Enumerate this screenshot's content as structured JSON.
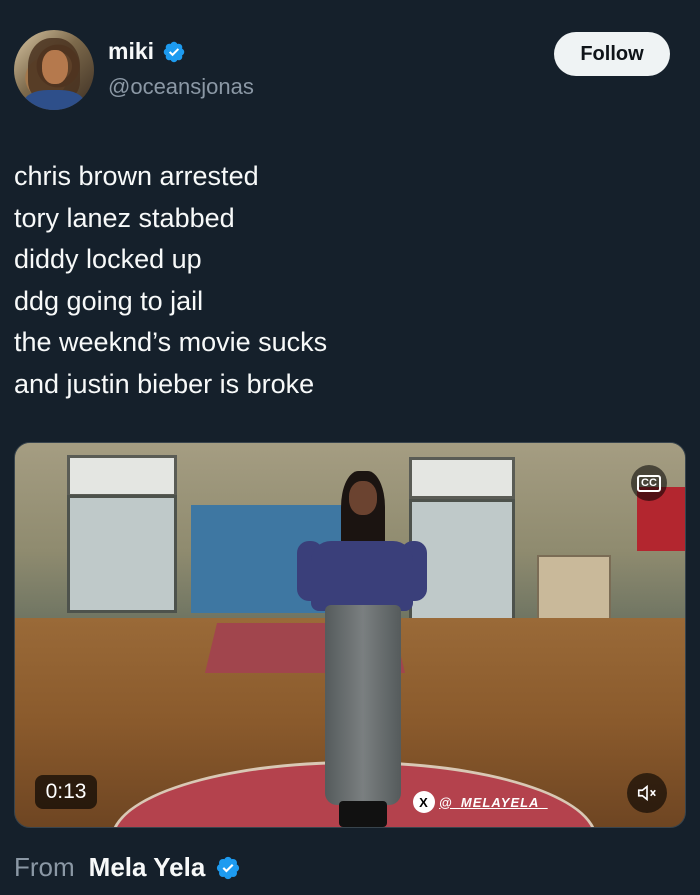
{
  "user": {
    "display_name": "miki",
    "handle": "@oceansjonas",
    "verified_icon": "verified-badge-icon",
    "verified_color": "#1d9bf0"
  },
  "follow_label": "Follow",
  "tweet": {
    "lines": [
      "chris brown arrested",
      "tory lanez stabbed",
      "diddy locked up",
      "ddg going to jail",
      "the weeknd’s movie sucks",
      "and justin bieber is broke"
    ]
  },
  "media": {
    "duration": "0:13",
    "captions_icon": "closed-captions-icon",
    "captions_label": "CC",
    "mute_icon": "speaker-muted-icon",
    "watermark_logo": "X",
    "watermark_text": "@_MELAYELA_"
  },
  "source": {
    "label": "From",
    "name": "Mela Yela",
    "verified_icon": "verified-badge-icon"
  },
  "colors": {
    "background": "#15202b",
    "primary_text": "#f7f9f9",
    "secondary_text": "#8b98a5",
    "follow_bg": "#eff3f4"
  }
}
